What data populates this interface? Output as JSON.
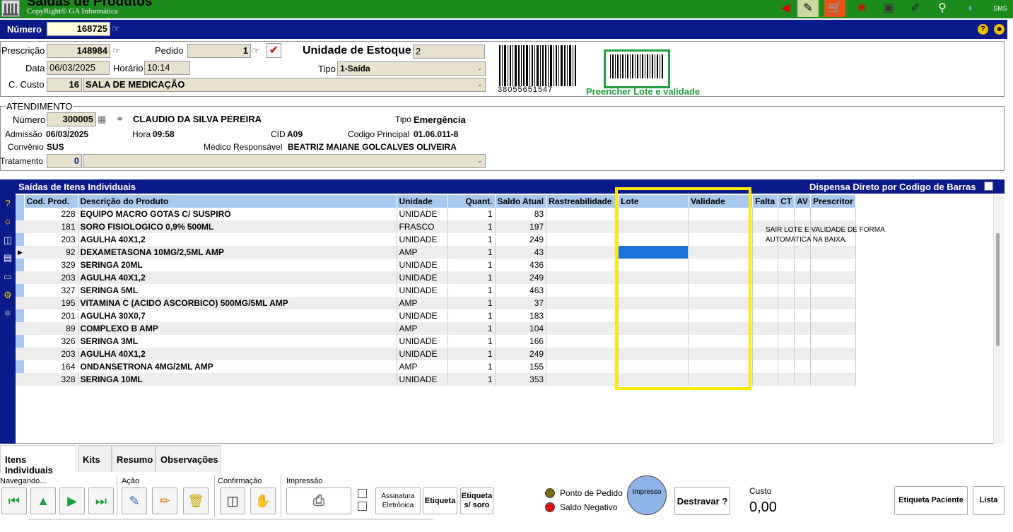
{
  "window": {
    "title": "Saídas de Produtos",
    "copyright": "CopyRight© GA Informática"
  },
  "toolbar_icons": [
    "back-arrow-icon",
    "cart-edit-icon",
    "cart-icon",
    "network-icon",
    "monitor-icon",
    "tools-icon",
    "search-icon",
    "globe-icon",
    "sms-icon"
  ],
  "header": {
    "numero_label": "Número",
    "numero_value": "168725"
  },
  "prescricao": {
    "prescricao_label": "Prescrição",
    "prescricao_value": "148984",
    "pedido_label": "Pedido",
    "pedido_value": "1",
    "unidade_label": "Unidade de Estoque",
    "unidade_value": "2",
    "data_label": "Data",
    "data_value": "06/03/2025",
    "horario_label": "Horário",
    "horario_value": "10:14",
    "tipo_label": "Tipo",
    "tipo_value": "1-Saída",
    "custo_label": "C. Custo",
    "custo_code": "16",
    "custo_value": "SALA DE MEDICAÇÃO",
    "barcode_text": "38055651547",
    "preencher": "Preencher Lote e validade"
  },
  "atendimento": {
    "section": "ATENDIMENTO",
    "numero_label": "Número",
    "numero_value": "300005",
    "paciente": "CLAUDIO DA SILVA PEREIRA",
    "tipo_label": "Tipo",
    "tipo_value": "Emergência",
    "admissao_label": "Admissão",
    "admissao_value": "06/03/2025",
    "hora_label": "Hora",
    "hora_value": "09:58",
    "cid_label": "CID",
    "cid_value": "A09",
    "codigo_label": "Codigo Principal",
    "codigo_value": "01.06.011-8",
    "convenio_label": "Convênio",
    "convenio_value": "SUS",
    "medico_label": "Médico Responsável",
    "medico_value": "BEATRIZ MAIANE GOLCALVES OLIVEIRA",
    "tratamento_label": "Tratamento",
    "tratamento_value": "0"
  },
  "grid": {
    "title": "Saídas de Itens Individuais",
    "dispensa": "Dispensa Direto por Codigo de Barras",
    "columns": [
      "Cod. Prod.",
      "Descrição do Produto",
      "Unidade",
      "Quant.",
      "Saldo Atual",
      "Rastreabilidade",
      "Lote",
      "Validade",
      "Falta",
      "CT",
      "AV",
      "Prescritor"
    ],
    "rows": [
      [
        "228",
        "EQUIPO MACRO GOTAS C/ SUSPIRO",
        "UNIDADE",
        "1",
        "83"
      ],
      [
        "181",
        "SORO FISIOLOGICO 0,9% 500ML",
        "FRASCO",
        "1",
        "197"
      ],
      [
        "203",
        "AGULHA 40X1,2",
        "UNIDADE",
        "1",
        "249"
      ],
      [
        "92",
        "DEXAMETASONA 10MG/2,5ML AMP",
        "AMP",
        "1",
        "43"
      ],
      [
        "329",
        "SERINGA 20ML",
        "UNIDADE",
        "1",
        "436"
      ],
      [
        "203",
        "AGULHA 40X1,2",
        "UNIDADE",
        "1",
        "249"
      ],
      [
        "327",
        "SERINGA 5ML",
        "UNIDADE",
        "1",
        "463"
      ],
      [
        "195",
        "VITAMINA C (ACIDO ASCORBICO) 500MG/5ML AMP",
        "AMP",
        "1",
        "37"
      ],
      [
        "201",
        "AGULHA 30X0,7",
        "UNIDADE",
        "1",
        "183"
      ],
      [
        "89",
        "COMPLEXO B AMP",
        "AMP",
        "1",
        "104"
      ],
      [
        "326",
        "SERINGA 3ML",
        "UNIDADE",
        "1",
        "166"
      ],
      [
        "203",
        "AGULHA 40X1,2",
        "UNIDADE",
        "1",
        "249"
      ],
      [
        "164",
        "ONDANSETRONA 4MG/2ML AMP",
        "AMP",
        "1",
        "155"
      ],
      [
        "328",
        "SERINGA 10ML",
        "UNIDADE",
        "1",
        "353"
      ]
    ],
    "annotation": "SAIR LOTE E VALIDADE DE FORMA AUTOMATICA NA BAIXA."
  },
  "tabs": [
    "Itens Individuais",
    "Kits",
    "Resumo",
    "Observações"
  ],
  "bottom": {
    "navegando": "Navegando...",
    "acao": "Ação",
    "confirmacao": "Confirmação",
    "impressao": "Impressão",
    "assinatura": "Assinatura Eletrônica",
    "etiqueta": "Etiqueta",
    "etiqueta_soro": "Etiqueta s/ soro",
    "ponto_pedido": "Ponto de Pedido",
    "saldo_negativo": "Saldo Negativo",
    "impresso": "Impresso",
    "destravar": "Destravar ?",
    "custo_label": "Custo",
    "custo_value": "0,00",
    "etiqueta_paciente": "Etiqueta Paciente",
    "lista": "Lista"
  },
  "colors": {
    "green": "#1d8a1d",
    "navy": "#0a1a8a",
    "header_blue": "#a8c8ee",
    "yellow": "#ffea00",
    "ok_green": "#1ea03a"
  }
}
